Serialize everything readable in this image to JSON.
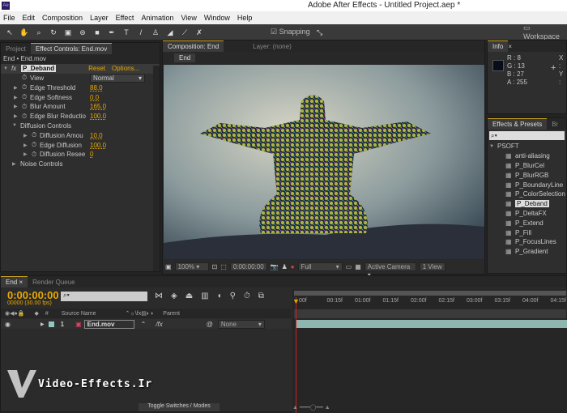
{
  "app": {
    "title": "Adobe After Effects - Untitled Project.aep *",
    "logo": "Ae"
  },
  "menu": [
    "File",
    "Edit",
    "Composition",
    "Layer",
    "Effect",
    "Animation",
    "View",
    "Window",
    "Help"
  ],
  "toolbar": {
    "snapping": "Snapping",
    "workspace": "Workspace"
  },
  "left_panel": {
    "tabs": [
      "Project",
      "Effect Controls: End.mov"
    ],
    "breadcrumb": "End • End.mov",
    "effect": {
      "name": "P_Deband",
      "reset": "Reset",
      "options": "Options...",
      "params": [
        {
          "label": "View",
          "value": "Normal",
          "type": "dropdown"
        },
        {
          "label": "Edge Threshold",
          "value": "88.0"
        },
        {
          "label": "Edge Softness",
          "value": "0.0"
        },
        {
          "label": "Blur Amount",
          "value": "165.0"
        },
        {
          "label": "Edge Blur Reductio",
          "value": "100.0"
        }
      ],
      "group": "Diffusion Controls",
      "group_params": [
        {
          "label": "Diffusion Amou",
          "value": "10.0"
        },
        {
          "label": "Edge Diffusion",
          "value": "100.0"
        },
        {
          "label": "Diffusion Resee",
          "value": "0"
        }
      ],
      "group2": "Noise Controls"
    }
  },
  "comp_panel": {
    "tabs": [
      "Composition: End",
      "Layer: (none)"
    ],
    "comp_button": "End",
    "footer": {
      "zoom": "100%",
      "timecode": "0:00:00:00",
      "resolution": "Full",
      "camera": "Active Camera",
      "views": "1 View"
    }
  },
  "info": {
    "tab": "Info",
    "R": "8",
    "G": "13",
    "B": "27",
    "A": "255",
    "color": "#080d1b",
    "x": "X :",
    "y": "Y :"
  },
  "effects_presets": {
    "tabs": [
      "Effects & Presets",
      "Br"
    ],
    "category": "PSOFT",
    "items": [
      "anti-aliasing",
      "P_BlurCel",
      "P_BlurRGB",
      "P_BoundaryLine",
      "P_ColorSelection",
      "P_Deband",
      "P_DeltaFX",
      "P_Extend",
      "P_Fill",
      "P_FocusLines",
      "P_Gradient"
    ],
    "selected": "P_Deband"
  },
  "timeline": {
    "tabs": [
      "End",
      "Render Queue"
    ],
    "timecode": "0:00:00:00",
    "fps": "00000 (30.00 fps)",
    "columns": {
      "num": "#",
      "source": "Source Name",
      "parent": "Parent"
    },
    "layer": {
      "index": "1",
      "name": "End.mov",
      "parent": "None"
    },
    "ruler": [
      "00f",
      "00:15f",
      "01:00f",
      "01:15f",
      "02:00f",
      "02:15f",
      "03:00f",
      "03:15f",
      "04:00f",
      "04:15f"
    ],
    "toggle": "Toggle Switches / Modes"
  },
  "watermark": "Video-Effects.Ir",
  "colors": {
    "accent": "#e8a800",
    "playhead": "#d02020",
    "layer_bar": "#8fb5b0"
  }
}
